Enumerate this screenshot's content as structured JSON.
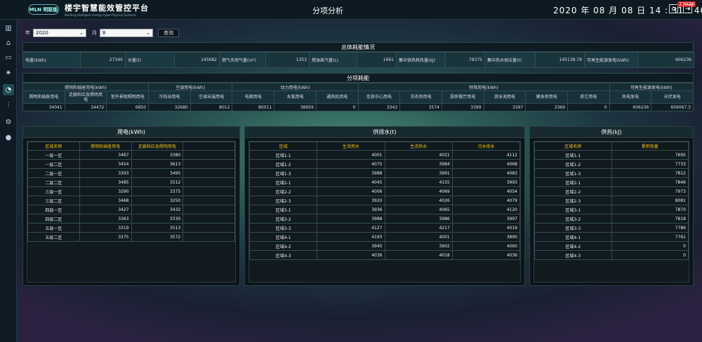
{
  "app": {
    "logo": "MLN 明联能",
    "title": "楼宇智慧能效管控平台",
    "subtitle": "Building Intelligent energy Cyber-Physical Systems",
    "page_title": "分项分析",
    "clock": "2020 年 08 月 08 日  14 : 31 : 46",
    "badge": "27026",
    "home_icon": "home-icon",
    "exit_icon": "exit-icon"
  },
  "sidebar": {
    "items": [
      {
        "icon": "building-icon"
      },
      {
        "icon": "home-icon"
      },
      {
        "icon": "monitor-icon"
      },
      {
        "icon": "alarm-icon"
      },
      {
        "icon": "pie-icon"
      },
      {
        "icon": "sliders-icon"
      },
      {
        "icon": "gear-icon"
      },
      {
        "icon": "user-icon"
      }
    ],
    "active": 4
  },
  "filter": {
    "year_label": "年",
    "year_value": "2020",
    "month_label": "月",
    "month_value": "8",
    "query_label": "查询"
  },
  "overall": {
    "title": "总体耗能情况",
    "items": [
      {
        "label": "电量(kWh)",
        "value": "27340"
      },
      {
        "label": "水量(t)",
        "value": "145682"
      },
      {
        "label": "燃气天然气量(m³)",
        "value": "1353"
      },
      {
        "label": "燃油蒸汽量(L)",
        "value": "1661"
      },
      {
        "label": "集中供热耗热量(kJ)",
        "value": "78375"
      },
      {
        "label": "集中热水供应量(t)",
        "value": "145138.79"
      },
      {
        "label": "可再生能源发电(kWh)",
        "value": "606236"
      }
    ]
  },
  "subitem": {
    "title": "分项耗能",
    "groups": [
      "照明和插座用电(kWh)",
      "空调用电(kWh)",
      "动力用电(kWh)",
      "特殊用电(kWh)",
      "可再生能源发电(kWh)"
    ],
    "headers": [
      "照明和插座用电",
      "走廊和应急照明用电",
      "室外景观照明用电",
      "冷热站用电",
      "空调末端用电",
      "电梯用电",
      "水泵用电",
      "通风机用电",
      "信息中心用电",
      "洗衣房用电",
      "厨房餐厅用电",
      "游泳池用电",
      "健身房用电",
      "其它用电",
      "风电发电",
      "光伏发电"
    ],
    "values": [
      "34041",
      "34472",
      "6850",
      "32680",
      "8012",
      "80011",
      "38959",
      "0",
      "3342",
      "3574",
      "3399",
      "3397",
      "3369",
      "0",
      "606236",
      "609067.3"
    ]
  },
  "electric": {
    "title": "用电(kWh)",
    "columns": [
      "区域名称",
      "照明和插座用电",
      "走廊和应急照明用电",
      ""
    ],
    "rows": [
      [
        "一层一区",
        "3467",
        "3380"
      ],
      [
        "一层二区",
        "3454",
        "3613"
      ],
      [
        "二层一区",
        "3393",
        "3495"
      ],
      [
        "二层二区",
        "3485",
        "3512"
      ],
      [
        "三层一区",
        "3290",
        "3375"
      ],
      [
        "三层二区",
        "3468",
        "3250"
      ],
      [
        "四层一区",
        "3427",
        "3432"
      ],
      [
        "四层二区",
        "3363",
        "3330"
      ],
      [
        "五层一区",
        "3319",
        "3513"
      ],
      [
        "五层二区",
        "3375",
        "3572"
      ]
    ]
  },
  "water": {
    "title": "供排水(t)",
    "columns": [
      "区域",
      "生活用水",
      "生活热水",
      "污水排水"
    ],
    "rows": [
      [
        "区域1-1",
        "4001",
        "4021",
        "4112"
      ],
      [
        "区域1-2",
        "4075",
        "3984",
        "4068"
      ],
      [
        "区域1-3",
        "3988",
        "3991",
        "4083"
      ],
      [
        "区域2-1",
        "4045",
        "4155",
        "3993"
      ],
      [
        "区域2-2",
        "4006",
        "4069",
        "4054"
      ],
      [
        "区域2-3",
        "3920",
        "4026",
        "4079"
      ],
      [
        "区域3-1",
        "3936",
        "4065",
        "4120"
      ],
      [
        "区域3-2",
        "3988",
        "3986",
        "3997"
      ],
      [
        "区域3-3",
        "4127",
        "4217",
        "4019"
      ],
      [
        "区域4-1",
        "4193",
        "4001",
        "3890"
      ],
      [
        "区域4-2",
        "3945",
        "3902",
        "4060"
      ],
      [
        "区域4-3",
        "4036",
        "4018",
        "4036"
      ]
    ]
  },
  "heat": {
    "title": "供热(kJ)",
    "columns": [
      "区域名称",
      "累积热量"
    ],
    "rows": [
      [
        "区域1-1",
        "7695"
      ],
      [
        "区域1-2",
        "7733"
      ],
      [
        "区域1-3",
        "7812"
      ],
      [
        "区域2-1",
        "7846"
      ],
      [
        "区域2-2",
        "7973"
      ],
      [
        "区域2-3",
        "8081"
      ],
      [
        "区域3-1",
        "7870"
      ],
      [
        "区域3-2",
        "7818"
      ],
      [
        "区域3-3",
        "7786"
      ],
      [
        "区域4-1",
        "7761"
      ],
      [
        "区域4-2",
        "0"
      ],
      [
        "区域4-3",
        "0"
      ]
    ]
  }
}
